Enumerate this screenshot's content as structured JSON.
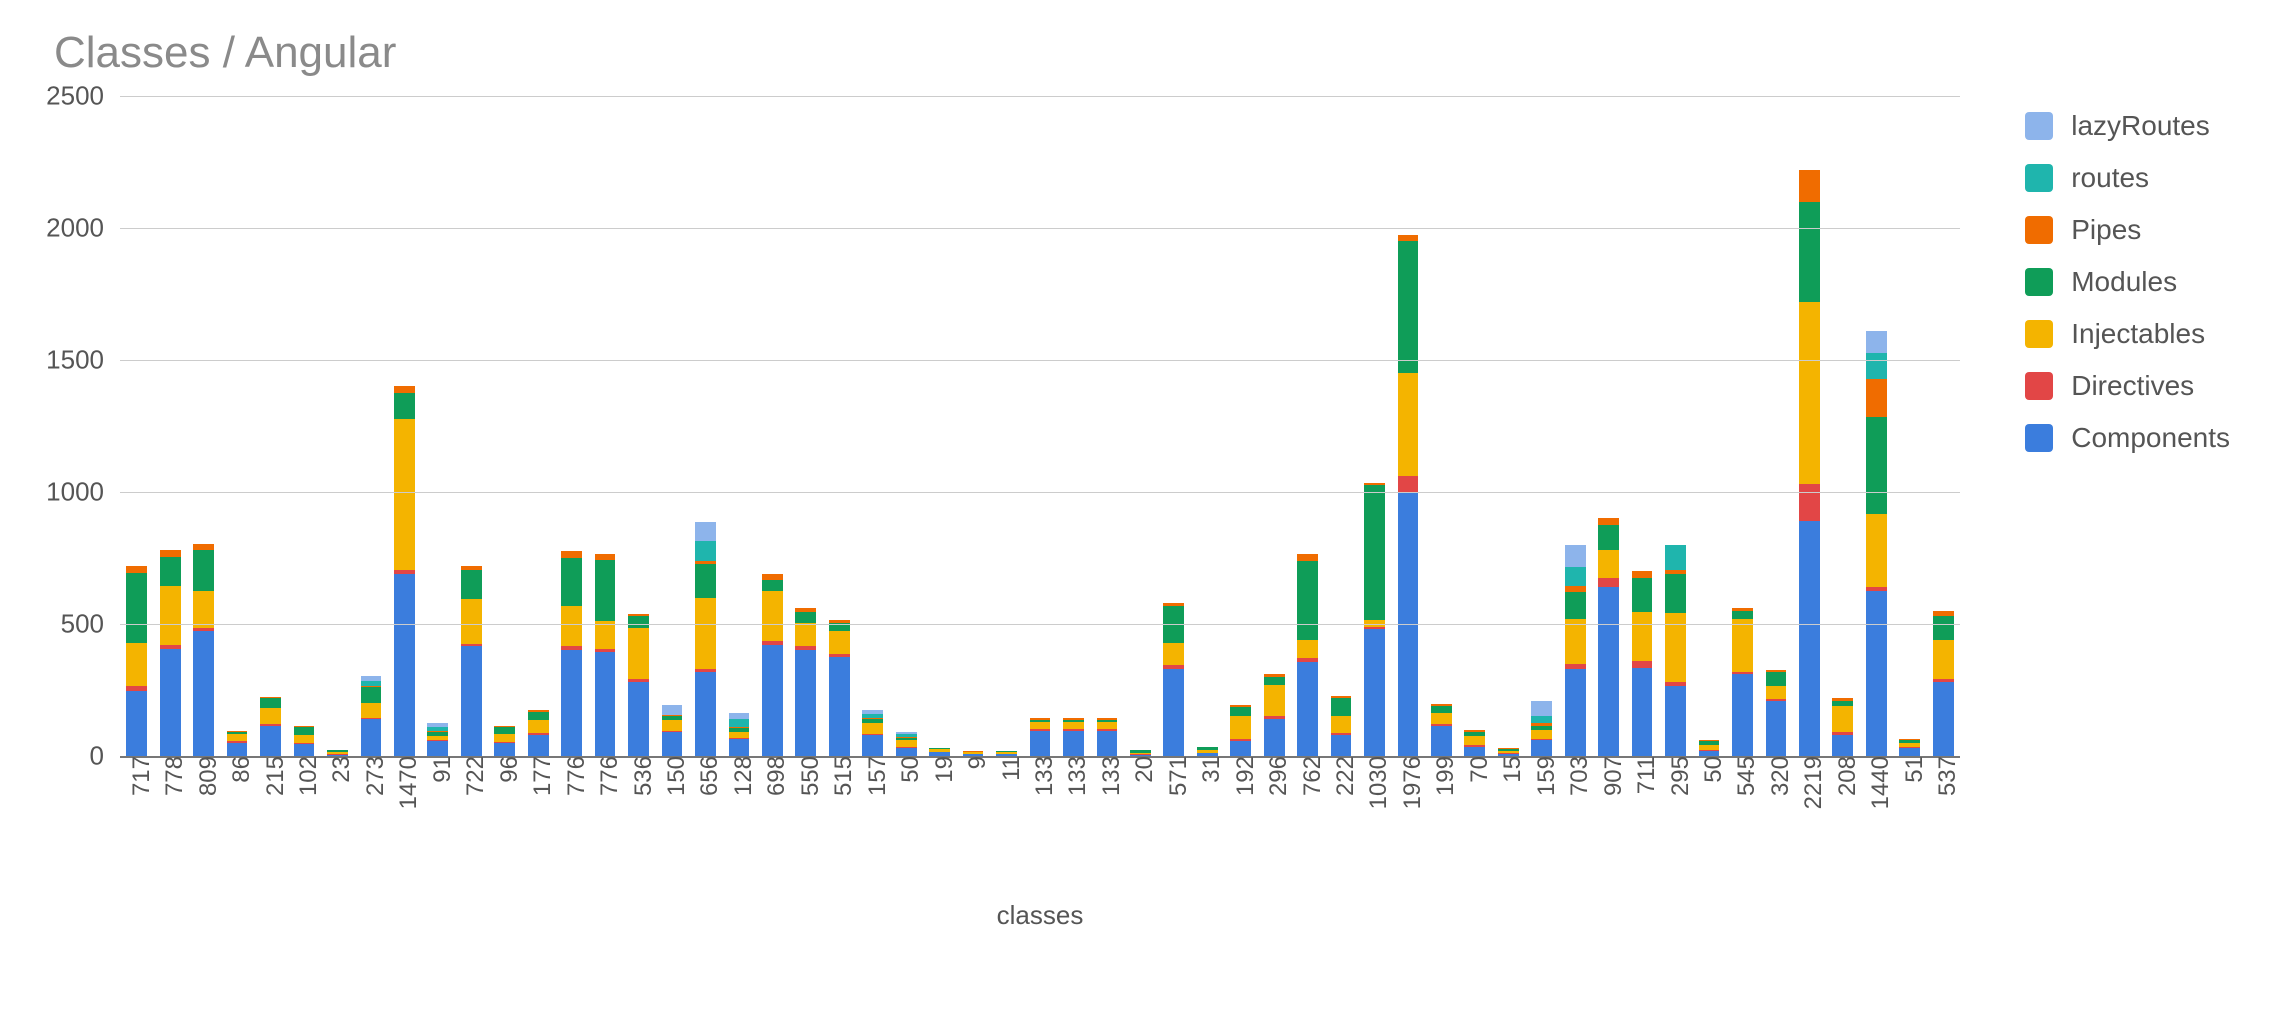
{
  "chart_data": {
    "type": "bar",
    "title": "Classes / Angular",
    "xlabel": "classes",
    "ylabel": "",
    "ylim": [
      0,
      2500
    ],
    "y_ticks": [
      0,
      500,
      1000,
      1500,
      2000,
      2500
    ],
    "legend_position": "right",
    "categories": [
      "717",
      "778",
      "809",
      "86",
      "215",
      "102",
      "23",
      "273",
      "1470",
      "91",
      "722",
      "96",
      "177",
      "776",
      "776",
      "536",
      "150",
      "656",
      "128",
      "698",
      "550",
      "515",
      "157",
      "50",
      "19",
      "9",
      "11",
      "133",
      "133",
      "133",
      "20",
      "571",
      "31",
      "192",
      "296",
      "762",
      "222",
      "1030",
      "1976",
      "199",
      "70",
      "15",
      "159",
      "703",
      "907",
      "711",
      "295",
      "50",
      "545",
      "320",
      "2219",
      "208",
      "1440",
      "51",
      "537"
    ],
    "series": [
      {
        "name": "Components",
        "color": "#3b7ddd",
        "values": [
          245,
          405,
          475,
          50,
          115,
          45,
          5,
          140,
          690,
          55,
          415,
          50,
          80,
          400,
          395,
          280,
          90,
          320,
          65,
          420,
          400,
          375,
          80,
          30,
          15,
          8,
          8,
          95,
          95,
          95,
          5,
          330,
          10,
          55,
          140,
          355,
          80,
          480,
          1000,
          115,
          35,
          8,
          60,
          330,
          640,
          335,
          265,
          20,
          310,
          210,
          890,
          80,
          625,
          30,
          280
        ]
      },
      {
        "name": "Directives",
        "color": "#e24646",
        "values": [
          20,
          15,
          10,
          8,
          8,
          5,
          3,
          5,
          15,
          5,
          8,
          5,
          8,
          15,
          12,
          10,
          5,
          8,
          5,
          15,
          15,
          10,
          5,
          5,
          2,
          1,
          1,
          8,
          8,
          8,
          2,
          15,
          3,
          10,
          10,
          15,
          8,
          10,
          60,
          8,
          5,
          2,
          5,
          20,
          35,
          25,
          15,
          3,
          10,
          5,
          140,
          10,
          15,
          5,
          10
        ]
      },
      {
        "name": "Injectables",
        "color": "#f4b400",
        "values": [
          165,
          225,
          140,
          25,
          60,
          30,
          8,
          55,
          570,
          15,
          170,
          30,
          50,
          155,
          105,
          195,
          40,
          270,
          20,
          190,
          90,
          90,
          40,
          25,
          8,
          5,
          5,
          25,
          25,
          25,
          6,
          85,
          10,
          85,
          120,
          70,
          65,
          25,
          390,
          40,
          35,
          8,
          35,
          170,
          105,
          185,
          260,
          20,
          200,
          50,
          690,
          100,
          275,
          15,
          150
        ]
      },
      {
        "name": "Modules",
        "color": "#0f9d58",
        "values": [
          265,
          110,
          155,
          8,
          35,
          30,
          5,
          60,
          100,
          15,
          110,
          25,
          30,
          180,
          230,
          45,
          15,
          130,
          15,
          40,
          40,
          30,
          15,
          10,
          5,
          3,
          4,
          10,
          10,
          10,
          8,
          140,
          10,
          35,
          30,
          300,
          65,
          510,
          500,
          25,
          15,
          8,
          15,
          100,
          95,
          130,
          150,
          15,
          30,
          55,
          380,
          20,
          370,
          10,
          90
        ]
      },
      {
        "name": "Pipes",
        "color": "#f06c00",
        "values": [
          25,
          25,
          25,
          5,
          5,
          3,
          3,
          5,
          25,
          5,
          15,
          5,
          5,
          25,
          25,
          10,
          5,
          10,
          5,
          25,
          15,
          10,
          5,
          3,
          2,
          1,
          1,
          5,
          5,
          5,
          2,
          10,
          3,
          10,
          10,
          25,
          8,
          10,
          25,
          10,
          10,
          3,
          10,
          25,
          25,
          25,
          15,
          3,
          10,
          5,
          120,
          10,
          145,
          5,
          20
        ]
      },
      {
        "name": "routes",
        "color": "#1fb5ad",
        "values": [
          0,
          0,
          0,
          0,
          0,
          0,
          0,
          20,
          0,
          15,
          0,
          0,
          0,
          0,
          0,
          0,
          0,
          75,
          30,
          0,
          0,
          0,
          15,
          10,
          0,
          0,
          0,
          0,
          0,
          0,
          0,
          0,
          0,
          0,
          0,
          0,
          0,
          0,
          0,
          0,
          0,
          0,
          25,
          70,
          0,
          0,
          95,
          0,
          0,
          0,
          0,
          0,
          95,
          0,
          0
        ]
      },
      {
        "name": "lazyRoutes",
        "color": "#8db4eb",
        "values": [
          0,
          0,
          0,
          0,
          0,
          0,
          0,
          20,
          0,
          15,
          0,
          0,
          0,
          0,
          0,
          0,
          40,
          75,
          25,
          0,
          0,
          0,
          15,
          10,
          0,
          0,
          0,
          0,
          0,
          0,
          0,
          0,
          0,
          0,
          0,
          0,
          0,
          0,
          0,
          0,
          0,
          0,
          60,
          85,
          0,
          0,
          0,
          0,
          0,
          0,
          0,
          0,
          85,
          0,
          0
        ]
      }
    ],
    "legend_order": [
      "lazyRoutes",
      "routes",
      "Pipes",
      "Modules",
      "Injectables",
      "Directives",
      "Components"
    ]
  }
}
